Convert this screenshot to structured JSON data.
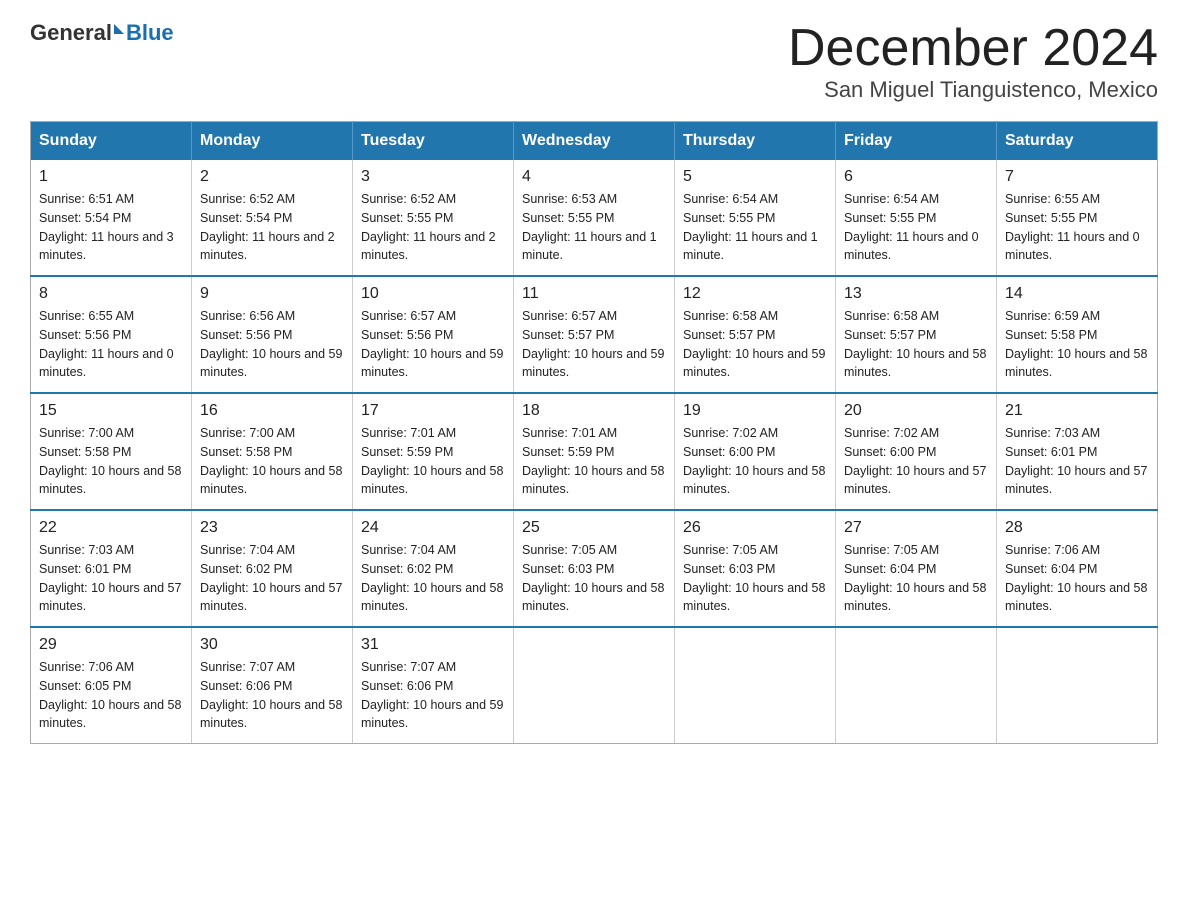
{
  "header": {
    "logo_general": "General",
    "logo_blue": "Blue",
    "month_title": "December 2024",
    "location": "San Miguel Tianguistenco, Mexico"
  },
  "weekdays": [
    "Sunday",
    "Monday",
    "Tuesday",
    "Wednesday",
    "Thursday",
    "Friday",
    "Saturday"
  ],
  "weeks": [
    [
      {
        "day": "1",
        "sunrise": "6:51 AM",
        "sunset": "5:54 PM",
        "daylight": "11 hours and 3 minutes."
      },
      {
        "day": "2",
        "sunrise": "6:52 AM",
        "sunset": "5:54 PM",
        "daylight": "11 hours and 2 minutes."
      },
      {
        "day": "3",
        "sunrise": "6:52 AM",
        "sunset": "5:55 PM",
        "daylight": "11 hours and 2 minutes."
      },
      {
        "day": "4",
        "sunrise": "6:53 AM",
        "sunset": "5:55 PM",
        "daylight": "11 hours and 1 minute."
      },
      {
        "day": "5",
        "sunrise": "6:54 AM",
        "sunset": "5:55 PM",
        "daylight": "11 hours and 1 minute."
      },
      {
        "day": "6",
        "sunrise": "6:54 AM",
        "sunset": "5:55 PM",
        "daylight": "11 hours and 0 minutes."
      },
      {
        "day": "7",
        "sunrise": "6:55 AM",
        "sunset": "5:55 PM",
        "daylight": "11 hours and 0 minutes."
      }
    ],
    [
      {
        "day": "8",
        "sunrise": "6:55 AM",
        "sunset": "5:56 PM",
        "daylight": "11 hours and 0 minutes."
      },
      {
        "day": "9",
        "sunrise": "6:56 AM",
        "sunset": "5:56 PM",
        "daylight": "10 hours and 59 minutes."
      },
      {
        "day": "10",
        "sunrise": "6:57 AM",
        "sunset": "5:56 PM",
        "daylight": "10 hours and 59 minutes."
      },
      {
        "day": "11",
        "sunrise": "6:57 AM",
        "sunset": "5:57 PM",
        "daylight": "10 hours and 59 minutes."
      },
      {
        "day": "12",
        "sunrise": "6:58 AM",
        "sunset": "5:57 PM",
        "daylight": "10 hours and 59 minutes."
      },
      {
        "day": "13",
        "sunrise": "6:58 AM",
        "sunset": "5:57 PM",
        "daylight": "10 hours and 58 minutes."
      },
      {
        "day": "14",
        "sunrise": "6:59 AM",
        "sunset": "5:58 PM",
        "daylight": "10 hours and 58 minutes."
      }
    ],
    [
      {
        "day": "15",
        "sunrise": "7:00 AM",
        "sunset": "5:58 PM",
        "daylight": "10 hours and 58 minutes."
      },
      {
        "day": "16",
        "sunrise": "7:00 AM",
        "sunset": "5:58 PM",
        "daylight": "10 hours and 58 minutes."
      },
      {
        "day": "17",
        "sunrise": "7:01 AM",
        "sunset": "5:59 PM",
        "daylight": "10 hours and 58 minutes."
      },
      {
        "day": "18",
        "sunrise": "7:01 AM",
        "sunset": "5:59 PM",
        "daylight": "10 hours and 58 minutes."
      },
      {
        "day": "19",
        "sunrise": "7:02 AM",
        "sunset": "6:00 PM",
        "daylight": "10 hours and 58 minutes."
      },
      {
        "day": "20",
        "sunrise": "7:02 AM",
        "sunset": "6:00 PM",
        "daylight": "10 hours and 57 minutes."
      },
      {
        "day": "21",
        "sunrise": "7:03 AM",
        "sunset": "6:01 PM",
        "daylight": "10 hours and 57 minutes."
      }
    ],
    [
      {
        "day": "22",
        "sunrise": "7:03 AM",
        "sunset": "6:01 PM",
        "daylight": "10 hours and 57 minutes."
      },
      {
        "day": "23",
        "sunrise": "7:04 AM",
        "sunset": "6:02 PM",
        "daylight": "10 hours and 57 minutes."
      },
      {
        "day": "24",
        "sunrise": "7:04 AM",
        "sunset": "6:02 PM",
        "daylight": "10 hours and 58 minutes."
      },
      {
        "day": "25",
        "sunrise": "7:05 AM",
        "sunset": "6:03 PM",
        "daylight": "10 hours and 58 minutes."
      },
      {
        "day": "26",
        "sunrise": "7:05 AM",
        "sunset": "6:03 PM",
        "daylight": "10 hours and 58 minutes."
      },
      {
        "day": "27",
        "sunrise": "7:05 AM",
        "sunset": "6:04 PM",
        "daylight": "10 hours and 58 minutes."
      },
      {
        "day": "28",
        "sunrise": "7:06 AM",
        "sunset": "6:04 PM",
        "daylight": "10 hours and 58 minutes."
      }
    ],
    [
      {
        "day": "29",
        "sunrise": "7:06 AM",
        "sunset": "6:05 PM",
        "daylight": "10 hours and 58 minutes."
      },
      {
        "day": "30",
        "sunrise": "7:07 AM",
        "sunset": "6:06 PM",
        "daylight": "10 hours and 58 minutes."
      },
      {
        "day": "31",
        "sunrise": "7:07 AM",
        "sunset": "6:06 PM",
        "daylight": "10 hours and 59 minutes."
      },
      null,
      null,
      null,
      null
    ]
  ]
}
